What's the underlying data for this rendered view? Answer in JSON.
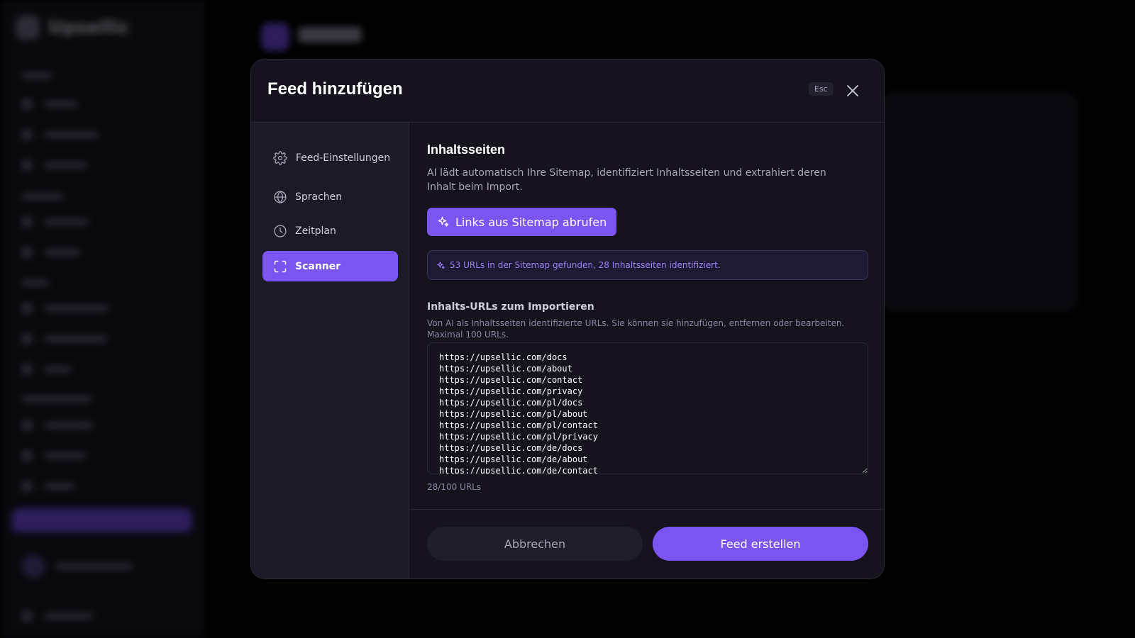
{
  "background": {
    "brand_name": "Upsellic",
    "page_title": "Feeds"
  },
  "modal": {
    "title": "Feed hinzufügen",
    "esc_label": "Esc",
    "nav": {
      "items": [
        {
          "label": "Feed-Einstellungen",
          "icon": "gear-icon",
          "active": false
        },
        {
          "label": "Sprachen",
          "icon": "globe-icon",
          "active": false
        },
        {
          "label": "Zeitplan",
          "icon": "clock-icon",
          "active": false
        },
        {
          "label": "Scanner",
          "icon": "scan-icon",
          "active": true
        }
      ]
    },
    "content": {
      "section_title": "Inhaltsseiten",
      "section_description": "AI lädt automatisch Ihre Sitemap, identifiziert Inhaltsseiten und extrahiert deren Inhalt beim Import.",
      "sitemap_button_label": "Links aus Sitemap abrufen",
      "info_message": "53 URLs in der Sitemap gefunden, 28 Inhaltsseiten identifiziert.",
      "urls_label": "Inhalts-URLs zum Importieren",
      "urls_help": "Von AI als Inhaltsseiten identifizierte URLs. Sie können sie hinzufügen, entfernen oder bearbeiten. Maximal 100 URLs.",
      "urls_value": "https://upsellic.com/docs\nhttps://upsellic.com/about\nhttps://upsellic.com/contact\nhttps://upsellic.com/privacy\nhttps://upsellic.com/pl/docs\nhttps://upsellic.com/pl/about\nhttps://upsellic.com/pl/contact\nhttps://upsellic.com/pl/privacy\nhttps://upsellic.com/de/docs\nhttps://upsellic.com/de/about\nhttps://upsellic.com/de/contact",
      "url_counter": "28/100 URLs"
    },
    "footer": {
      "cancel_label": "Abbrechen",
      "create_label": "Feed erstellen"
    }
  },
  "colors": {
    "accent": "#7b55f2",
    "modal_bg": "#16131f",
    "nav_bg": "#1d1a28",
    "info_text": "#9b7ff5"
  }
}
